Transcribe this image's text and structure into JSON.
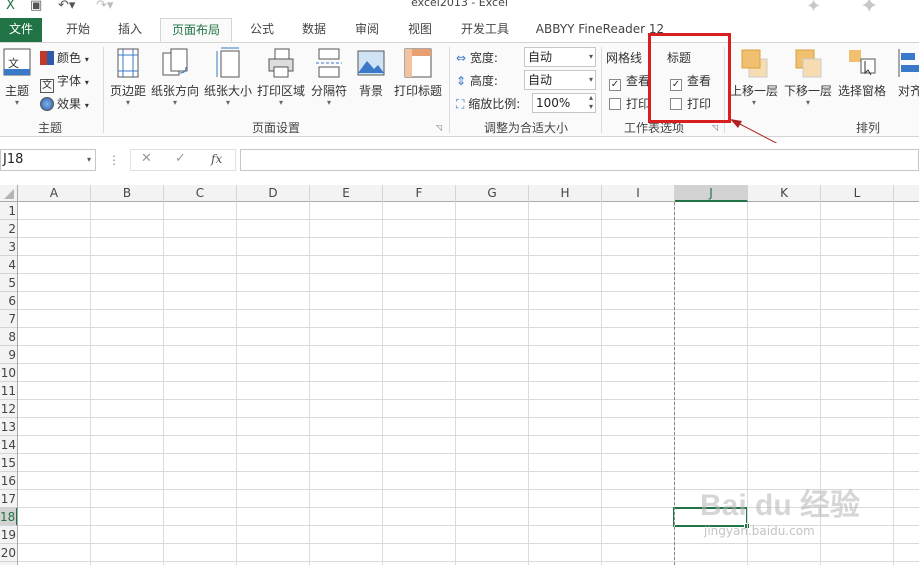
{
  "window": {
    "title": "excel2013 - Excel"
  },
  "tabs": [
    {
      "id": "file",
      "label": "文件"
    },
    {
      "id": "home",
      "label": "开始"
    },
    {
      "id": "insert",
      "label": "插入"
    },
    {
      "id": "pagelayout",
      "label": "页面布局"
    },
    {
      "id": "formulas",
      "label": "公式"
    },
    {
      "id": "data",
      "label": "数据"
    },
    {
      "id": "review",
      "label": "审阅"
    },
    {
      "id": "view",
      "label": "视图"
    },
    {
      "id": "developer",
      "label": "开发工具"
    },
    {
      "id": "abbyy",
      "label": "ABBYY FineReader 12"
    }
  ],
  "ribbon": {
    "themes": {
      "group_label": "主题",
      "themes_btn": "主题",
      "colors": "颜色",
      "fonts": "字体",
      "effects": "效果"
    },
    "page_setup": {
      "group_label": "页面设置",
      "margins": "页边距",
      "orientation": "纸张方向",
      "size": "纸张大小",
      "print_area": "打印区域",
      "breaks": "分隔符",
      "background": "背景",
      "print_titles": "打印标题"
    },
    "scale_to_fit": {
      "group_label": "调整为合适大小",
      "width_label": "宽度:",
      "width_value": "自动",
      "height_label": "高度:",
      "height_value": "自动",
      "scale_label": "缩放比例:",
      "scale_value": "100%"
    },
    "sheet_options": {
      "group_label": "工作表选项",
      "gridlines_label": "网格线",
      "gridlines_view": "查看",
      "gridlines_print": "打印",
      "headings_label": "标题",
      "headings_view": "查看",
      "headings_print": "打印"
    },
    "arrange": {
      "group_label": "排列",
      "bring_forward": "上移一层",
      "send_backward": "下移一层",
      "selection_pane": "选择窗格",
      "align": "对齐"
    }
  },
  "formula_bar": {
    "name_box": "J18",
    "cancel_glyph": "✕",
    "enter_glyph": "✓",
    "fx_glyph": "fx",
    "content": ""
  },
  "grid": {
    "columns": [
      "A",
      "B",
      "C",
      "D",
      "E",
      "F",
      "G",
      "H",
      "I",
      "J",
      "K",
      "L"
    ],
    "rows": [
      "1",
      "2",
      "3",
      "4",
      "5",
      "6",
      "7",
      "8",
      "9",
      "10",
      "11",
      "12",
      "13",
      "14",
      "15",
      "16",
      "17",
      "18",
      "19",
      "20"
    ],
    "selected_column": "J",
    "selected_row": "18"
  },
  "watermark": {
    "brand": "Bai du 经验",
    "url": "jingyan.baidu.com"
  }
}
